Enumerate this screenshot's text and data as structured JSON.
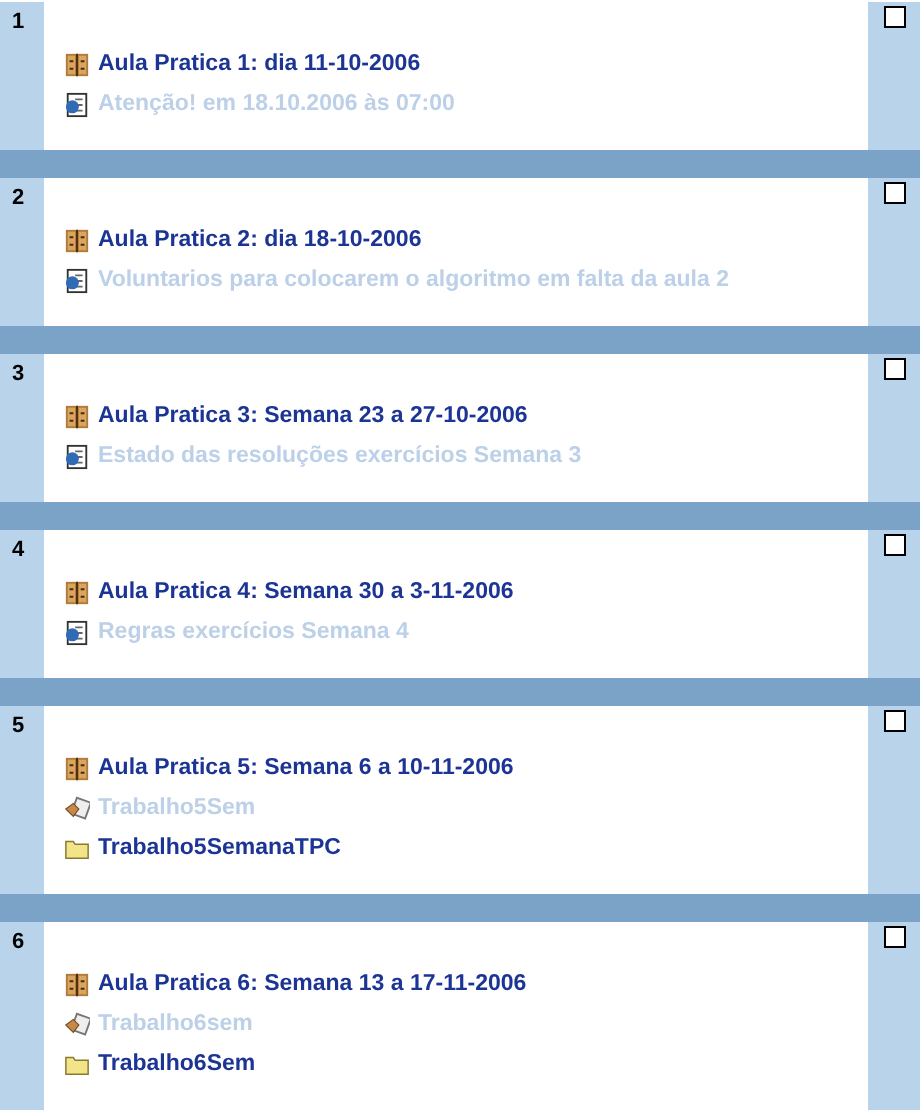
{
  "sections": [
    {
      "number": "1",
      "checked": false,
      "items": [
        {
          "kind": "lesson",
          "text": "Aula Pratica 1: dia 11-10-2006",
          "hidden": false
        },
        {
          "kind": "page",
          "text": "Atenção! em 18.10.2006 às 07:00",
          "hidden": true
        }
      ]
    },
    {
      "number": "2",
      "checked": false,
      "items": [
        {
          "kind": "lesson",
          "text": "Aula Pratica 2: dia 18-10-2006",
          "hidden": false
        },
        {
          "kind": "page",
          "text": "Voluntarios para colocarem o algoritmo em falta da aula 2",
          "hidden": true
        }
      ]
    },
    {
      "number": "3",
      "checked": false,
      "items": [
        {
          "kind": "lesson",
          "text": "Aula Pratica 3: Semana 23 a 27-10-2006",
          "hidden": false
        },
        {
          "kind": "page",
          "text": "Estado das resoluções exercícios Semana 3",
          "hidden": true
        }
      ]
    },
    {
      "number": "4",
      "checked": false,
      "items": [
        {
          "kind": "lesson",
          "text": "Aula Pratica 4: Semana 30 a 3-11-2006",
          "hidden": false
        },
        {
          "kind": "page",
          "text": "Regras exercícios Semana 4",
          "hidden": true
        }
      ]
    },
    {
      "number": "5",
      "checked": false,
      "items": [
        {
          "kind": "lesson",
          "text": "Aula Pratica 5: Semana 6 a 10-11-2006",
          "hidden": false
        },
        {
          "kind": "assignment",
          "text": "Trabalho5Sem",
          "hidden": true
        },
        {
          "kind": "folder",
          "text": "Trabalho5SemanaTPC",
          "hidden": false
        }
      ]
    },
    {
      "number": "6",
      "checked": false,
      "items": [
        {
          "kind": "lesson",
          "text": "Aula Pratica 6: Semana 13 a 17-11-2006",
          "hidden": false
        },
        {
          "kind": "assignment",
          "text": "Trabalho6sem",
          "hidden": true
        },
        {
          "kind": "folder",
          "text": "Trabalho6Sem",
          "hidden": false
        }
      ]
    }
  ]
}
